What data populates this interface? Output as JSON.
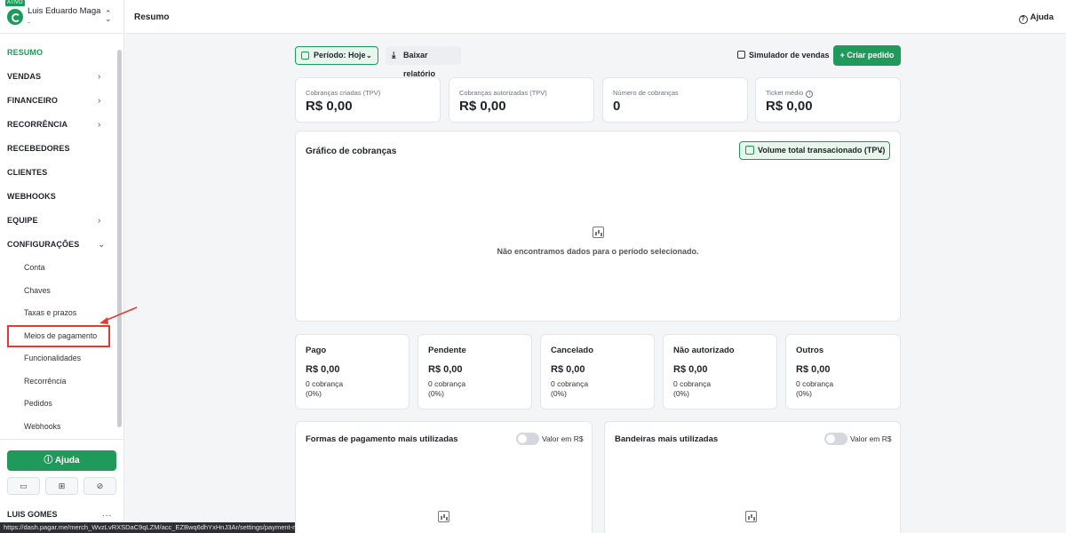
{
  "account": {
    "badge": "ATIVO",
    "name": "Luis Eduardo Magalh...",
    "sub": "-"
  },
  "nav": {
    "items": [
      {
        "label": "RESUMO",
        "active": true,
        "chevron": ""
      },
      {
        "label": "VENDAS",
        "chevron": "›"
      },
      {
        "label": "FINANCEIRO",
        "chevron": "›"
      },
      {
        "label": "RECORRÊNCIA",
        "chevron": "›"
      },
      {
        "label": "RECEBEDORES",
        "chevron": ""
      },
      {
        "label": "CLIENTES",
        "chevron": ""
      },
      {
        "label": "WEBHOOKS",
        "chevron": ""
      },
      {
        "label": "EQUIPE",
        "chevron": "›"
      },
      {
        "label": "CONFIGURAÇÕES",
        "chevron": "⌄"
      }
    ],
    "sub_items": [
      "Conta",
      "Chaves",
      "Taxas e prazos",
      "Meios de pagamento",
      "Funcionalidades",
      "Recorrência",
      "Pedidos",
      "Webhooks"
    ]
  },
  "sidebar_bottom": {
    "help_label": "Ajuda",
    "user_name": "LUIS GOMES",
    "menu": "..."
  },
  "status_url": "https://dash.pagar.me/merch_WvzLvRXSDaC9qLZM/acc_EZBwq6dhYxHnJ3Ar/settings/payment-methods",
  "header": {
    "title": "Resumo",
    "help": "Ajuda"
  },
  "toolbar": {
    "period": "Período: Hoje",
    "download": "Baixar relatório",
    "simulator": "Simulador de vendas",
    "create": "+ Criar pedido"
  },
  "kpis": [
    {
      "label": "Cobranças criadas (TPV)",
      "value": "R$ 0,00"
    },
    {
      "label": "Cobranças autorizadas (TPV)",
      "value": "R$ 0,00"
    },
    {
      "label": "Número de cobranças",
      "value": "0"
    },
    {
      "label": "Ticket médio",
      "value": "R$ 0,00"
    }
  ],
  "chart": {
    "title": "Gráfico de cobranças",
    "metric": "Volume total transacionado (TPV)",
    "empty_text": "Não encontramos dados para o período selecionado."
  },
  "statuses": [
    {
      "label": "Pago",
      "value": "R$ 0,00",
      "count": "0 cobrança",
      "pct": "(0%)"
    },
    {
      "label": "Pendente",
      "value": "R$ 0,00",
      "count": "0 cobrança",
      "pct": "(0%)"
    },
    {
      "label": "Cancelado",
      "value": "R$ 0,00",
      "count": "0 cobrança",
      "pct": "(0%)"
    },
    {
      "label": "Não autorizado",
      "value": "R$ 0,00",
      "count": "0 cobrança",
      "pct": "(0%)"
    },
    {
      "label": "Outros",
      "value": "R$ 0,00",
      "count": "0 cobrança",
      "pct": "(0%)"
    }
  ],
  "bottom_cards": [
    {
      "title": "Formas de pagamento mais utilizadas",
      "toggle_label": "Valor em R$"
    },
    {
      "title": "Bandeiras mais utilizadas",
      "toggle_label": "Valor em R$"
    }
  ],
  "colors": {
    "accent": "#1f9a5b",
    "accent_soft": "#e7f5ec",
    "annotation": "#e53935"
  }
}
